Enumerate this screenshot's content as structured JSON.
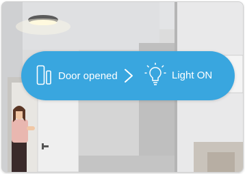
{
  "overlay": {
    "trigger_label": "Door opened",
    "action_label": "Light ON",
    "trigger_icon": "door-sensor-icon",
    "arrow_icon": "chevron-right-icon",
    "action_icon": "light-bulb-icon",
    "badge_color": "#39a6df"
  }
}
